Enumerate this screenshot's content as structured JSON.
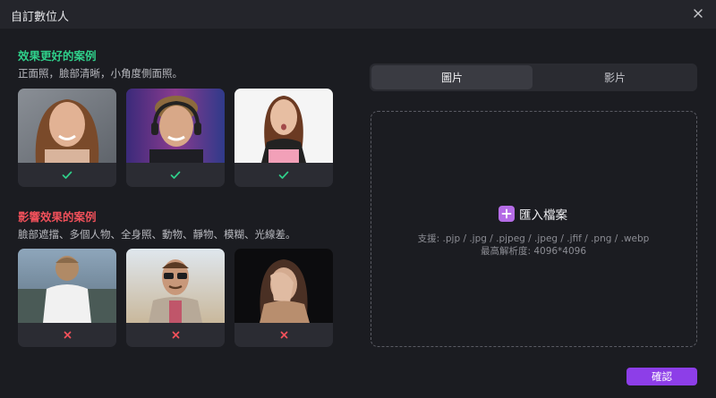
{
  "window": {
    "title": "自訂數位人",
    "close_icon": "close-icon"
  },
  "good": {
    "title": "效果更好的案例",
    "description": "正面照，臉部清晰，小角度側面照。",
    "color": "#2fcf8a",
    "cards": [
      {
        "photo": "smiling woman portrait",
        "mark_icon": "check-icon"
      },
      {
        "photo": "man with headset portrait",
        "mark_icon": "check-icon"
      },
      {
        "photo": "woman on white background",
        "mark_icon": "check-icon"
      }
    ]
  },
  "bad": {
    "title": "影響效果的案例",
    "description": "臉部遮擋、多個人物、全身照、動物、靜物、模糊、光線差。",
    "color": "#f0505a",
    "cards": [
      {
        "photo": "person from behind",
        "mark_icon": "cross-icon"
      },
      {
        "photo": "man with sunglasses",
        "mark_icon": "cross-icon"
      },
      {
        "photo": "woman covering face",
        "mark_icon": "cross-icon"
      }
    ]
  },
  "tabs": [
    {
      "label": "圖片",
      "active": true
    },
    {
      "label": "影片",
      "active": false
    }
  ],
  "upload": {
    "import_label": "匯入檔案",
    "supported_formats": "支援: .pjp / .jpg / .pjpeg / .jpeg / .jfif / .png / .webp",
    "max_resolution": "最高解析度: 4096*4096"
  },
  "confirm_label": "確認",
  "accent": "#8d3ee8"
}
